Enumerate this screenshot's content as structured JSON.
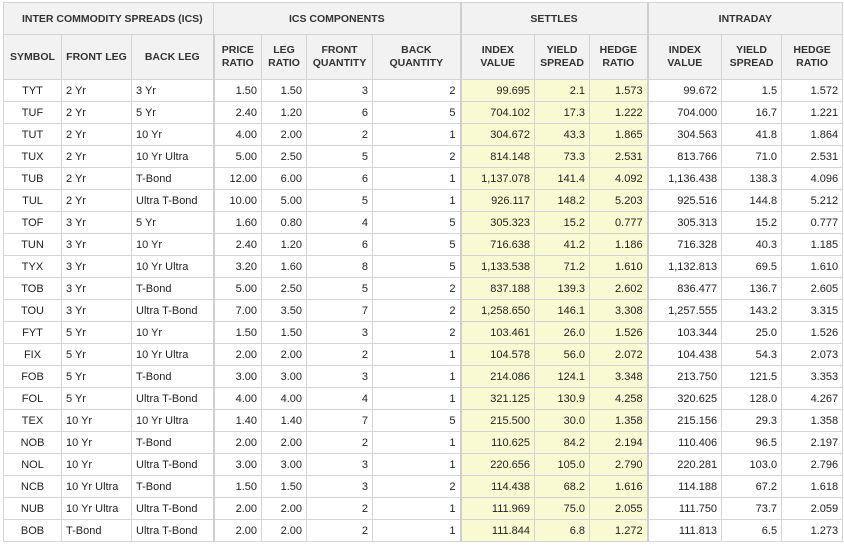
{
  "header": {
    "groups": {
      "ics": "INTER COMMODITY SPREADS (ICS)",
      "components": "ICS COMPONENTS",
      "settles": "SETTLES",
      "intraday": "INTRADAY"
    },
    "columns": {
      "symbol": "SYMBOL",
      "front_leg": "FRONT LEG",
      "back_leg": "BACK LEG",
      "price_ratio": "PRICE RATIO",
      "leg_ratio": "LEG RATIO",
      "front_quantity": "FRONT QUANTITY",
      "back_quantity": "BACK QUANTITY",
      "settle_index_value": "INDEX VALUE",
      "settle_yield_spread": "YIELD SPREAD",
      "settle_hedge_ratio": "HEDGE RATIO",
      "intraday_index_value": "INDEX VALUE",
      "intraday_yield_spread": "YIELD SPREAD",
      "intraday_hedge_ratio": "HEDGE RATIO"
    }
  },
  "colors": {
    "settle_highlight": "#fafad2",
    "header_bg": "#f2f2f2",
    "grid": "#d4d4d4"
  },
  "rows": [
    [
      "TYT",
      "2 Yr",
      "3 Yr",
      "1.50",
      "1.50",
      "3",
      "2",
      "99.695",
      "2.1",
      "1.573",
      "99.672",
      "1.5",
      "1.572"
    ],
    [
      "TUF",
      "2 Yr",
      "5 Yr",
      "2.40",
      "1.20",
      "6",
      "5",
      "704.102",
      "17.3",
      "1.222",
      "704.000",
      "16.7",
      "1.221"
    ],
    [
      "TUT",
      "2 Yr",
      "10 Yr",
      "4.00",
      "2.00",
      "2",
      "1",
      "304.672",
      "43.3",
      "1.865",
      "304.563",
      "41.8",
      "1.864"
    ],
    [
      "TUX",
      "2 Yr",
      "10 Yr Ultra",
      "5.00",
      "2.50",
      "5",
      "2",
      "814.148",
      "73.3",
      "2.531",
      "813.766",
      "71.0",
      "2.531"
    ],
    [
      "TUB",
      "2 Yr",
      "T-Bond",
      "12.00",
      "6.00",
      "6",
      "1",
      "1,137.078",
      "141.4",
      "4.092",
      "1,136.438",
      "138.3",
      "4.096"
    ],
    [
      "TUL",
      "2 Yr",
      "Ultra T-Bond",
      "10.00",
      "5.00",
      "5",
      "1",
      "926.117",
      "148.2",
      "5.203",
      "925.516",
      "144.8",
      "5.212"
    ],
    [
      "TOF",
      "3 Yr",
      "5 Yr",
      "1.60",
      "0.80",
      "4",
      "5",
      "305.323",
      "15.2",
      "0.777",
      "305.313",
      "15.2",
      "0.777"
    ],
    [
      "TUN",
      "3 Yr",
      "10 Yr",
      "2.40",
      "1.20",
      "6",
      "5",
      "716.638",
      "41.2",
      "1.186",
      "716.328",
      "40.3",
      "1.185"
    ],
    [
      "TYX",
      "3 Yr",
      "10 Yr Ultra",
      "3.20",
      "1.60",
      "8",
      "5",
      "1,133.538",
      "71.2",
      "1.610",
      "1,132.813",
      "69.5",
      "1.610"
    ],
    [
      "TOB",
      "3 Yr",
      "T-Bond",
      "5.00",
      "2.50",
      "5",
      "2",
      "837.188",
      "139.3",
      "2.602",
      "836.477",
      "136.7",
      "2.605"
    ],
    [
      "TOU",
      "3 Yr",
      "Ultra T-Bond",
      "7.00",
      "3.50",
      "7",
      "2",
      "1,258.650",
      "146.1",
      "3.308",
      "1,257.555",
      "143.2",
      "3.315"
    ],
    [
      "FYT",
      "5 Yr",
      "10 Yr",
      "1.50",
      "1.50",
      "3",
      "2",
      "103.461",
      "26.0",
      "1.526",
      "103.344",
      "25.0",
      "1.526"
    ],
    [
      "FIX",
      "5 Yr",
      "10 Yr Ultra",
      "2.00",
      "2.00",
      "2",
      "1",
      "104.578",
      "56.0",
      "2.072",
      "104.438",
      "54.3",
      "2.073"
    ],
    [
      "FOB",
      "5 Yr",
      "T-Bond",
      "3.00",
      "3.00",
      "3",
      "1",
      "214.086",
      "124.1",
      "3.348",
      "213.750",
      "121.5",
      "3.353"
    ],
    [
      "FOL",
      "5 Yr",
      "Ultra T-Bond",
      "4.00",
      "4.00",
      "4",
      "1",
      "321.125",
      "130.9",
      "4.258",
      "320.625",
      "128.0",
      "4.267"
    ],
    [
      "TEX",
      "10 Yr",
      "10 Yr Ultra",
      "1.40",
      "1.40",
      "7",
      "5",
      "215.500",
      "30.0",
      "1.358",
      "215.156",
      "29.3",
      "1.358"
    ],
    [
      "NOB",
      "10 Yr",
      "T-Bond",
      "2.00",
      "2.00",
      "2",
      "1",
      "110.625",
      "84.2",
      "2.194",
      "110.406",
      "96.5",
      "2.197"
    ],
    [
      "NOL",
      "10 Yr",
      "Ultra T-Bond",
      "3.00",
      "3.00",
      "3",
      "1",
      "220.656",
      "105.0",
      "2.790",
      "220.281",
      "103.0",
      "2.796"
    ],
    [
      "NCB",
      "10 Yr Ultra",
      "T-Bond",
      "1.50",
      "1.50",
      "3",
      "2",
      "114.438",
      "68.2",
      "1.616",
      "114.188",
      "67.2",
      "1.618"
    ],
    [
      "NUB",
      "10 Yr Ultra",
      "Ultra T-Bond",
      "2.00",
      "2.00",
      "2",
      "1",
      "111.969",
      "75.0",
      "2.055",
      "111.750",
      "73.7",
      "2.059"
    ],
    [
      "BOB",
      "T-Bond",
      "Ultra T-Bond",
      "2.00",
      "2.00",
      "2",
      "1",
      "111.844",
      "6.8",
      "1.272",
      "111.813",
      "6.5",
      "1.273"
    ]
  ]
}
